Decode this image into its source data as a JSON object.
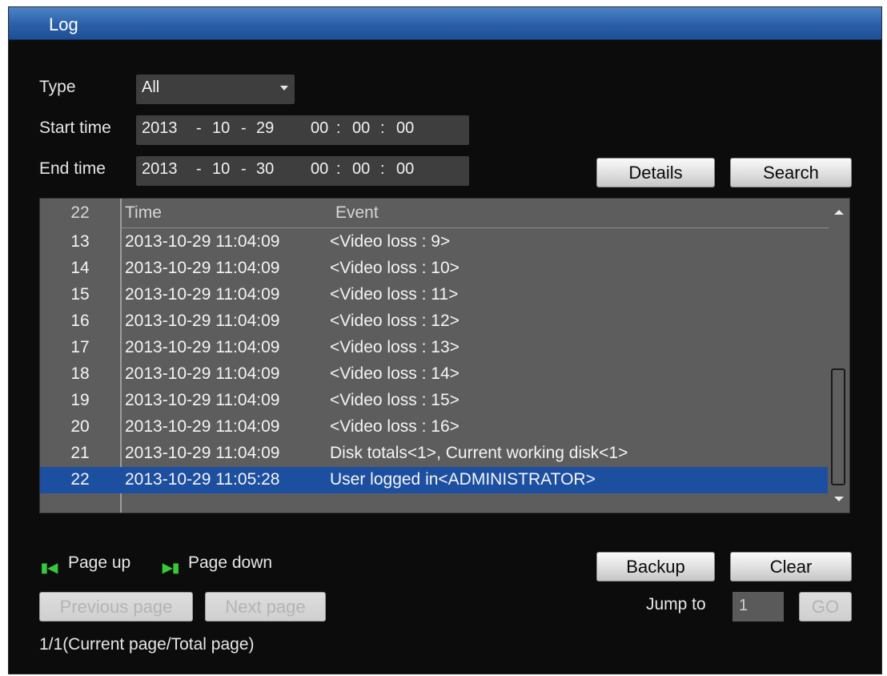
{
  "window": {
    "title": "Log"
  },
  "filters": {
    "type_label": "Type",
    "type_value": "All",
    "start_label": "Start time",
    "start": {
      "year": "2013",
      "month": "10",
      "day": "29",
      "hh": "00",
      "mm": "00",
      "ss": "00"
    },
    "end_label": "End time",
    "end": {
      "year": "2013",
      "month": "10",
      "day": "30",
      "hh": "00",
      "mm": "00",
      "ss": "00"
    },
    "date_sep": "-",
    "time_sep": ":"
  },
  "buttons": {
    "details": "Details",
    "search": "Search",
    "backup": "Backup",
    "clear": "Clear",
    "previous_page": "Previous page",
    "next_page": "Next page",
    "go": "GO"
  },
  "log_table": {
    "count": "22",
    "col_time": "Time",
    "col_event": "Event",
    "rows": [
      {
        "no": "13",
        "time": "2013-10-29 11:04:09",
        "event": "<Video loss : 9>"
      },
      {
        "no": "14",
        "time": "2013-10-29 11:04:09",
        "event": "<Video loss : 10>"
      },
      {
        "no": "15",
        "time": "2013-10-29 11:04:09",
        "event": "<Video loss : 11>"
      },
      {
        "no": "16",
        "time": "2013-10-29 11:04:09",
        "event": "<Video loss : 12>"
      },
      {
        "no": "17",
        "time": "2013-10-29 11:04:09",
        "event": "<Video loss : 13>"
      },
      {
        "no": "18",
        "time": "2013-10-29 11:04:09",
        "event": "<Video loss : 14>"
      },
      {
        "no": "19",
        "time": "2013-10-29 11:04:09",
        "event": "<Video loss : 15>"
      },
      {
        "no": "20",
        "time": "2013-10-29 11:04:09",
        "event": "<Video loss : 16>"
      },
      {
        "no": "21",
        "time": "2013-10-29 11:04:09",
        "event": "Disk totals<1>, Current working disk<1>"
      },
      {
        "no": "22",
        "time": "2013-10-29 11:05:28",
        "event": "User logged in<ADMINISTRATOR>"
      }
    ],
    "selected_row": "22"
  },
  "paging": {
    "page_up": "Page up",
    "page_down": "Page down",
    "jump_label": "Jump to",
    "jump_value": "1",
    "status": "1/1(Current page/Total page)"
  }
}
